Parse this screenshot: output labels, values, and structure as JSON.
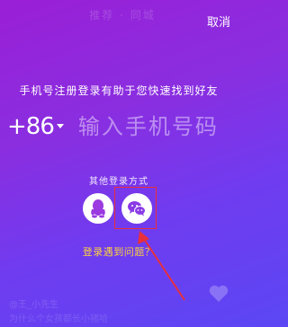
{
  "header": {
    "faded_title": "推荐 · 同城",
    "cancel_label": "取消"
  },
  "login": {
    "tagline": "手机号注册登录有助于您快速找到好友",
    "country_code": "+86",
    "phone_placeholder": "输入手机号码"
  },
  "other_login": {
    "label": "其他登录方式",
    "options": [
      {
        "name": "qq",
        "icon": "qq-penguin-icon"
      },
      {
        "name": "wechat",
        "icon": "wechat-icon"
      }
    ]
  },
  "trouble_link": "登录遇到问题？",
  "background_watermark": {
    "user": "@王_小先生",
    "caption": "为什么个女孩都长小猪哈"
  },
  "colors": {
    "gradient_top": "#9a1fd6",
    "gradient_bottom": "#5b47f4",
    "link": "#ffd23d",
    "annotation": "#e8303c"
  }
}
